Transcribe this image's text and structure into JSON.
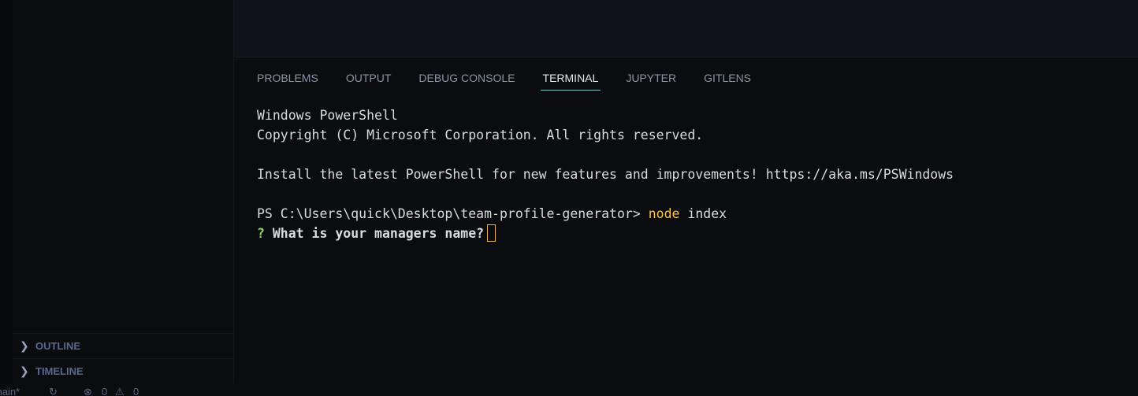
{
  "sidebar": {
    "sections": [
      {
        "label": "OUTLINE",
        "icon": "chevron-right-icon"
      },
      {
        "label": "TIMELINE",
        "icon": "chevron-right-icon"
      }
    ]
  },
  "panel": {
    "tabs": [
      "PROBLEMS",
      "OUTPUT",
      "DEBUG CONSOLE",
      "TERMINAL",
      "JUPYTER",
      "GITLENS"
    ],
    "active_tab": "TERMINAL"
  },
  "terminal": {
    "line1": "Windows PowerShell",
    "line2": "Copyright (C) Microsoft Corporation. All rights reserved.",
    "line3": "Install the latest PowerShell for new features and improvements! https://aka.ms/PSWindows",
    "prompt": "PS C:\\Users\\quick\\Desktop\\team-profile-generator> ",
    "command": "node",
    "args": " index",
    "question_mark": "?",
    "question": " What is your managers name?"
  },
  "status": {
    "branch": "main*",
    "errors": "0",
    "warnings": "0"
  }
}
